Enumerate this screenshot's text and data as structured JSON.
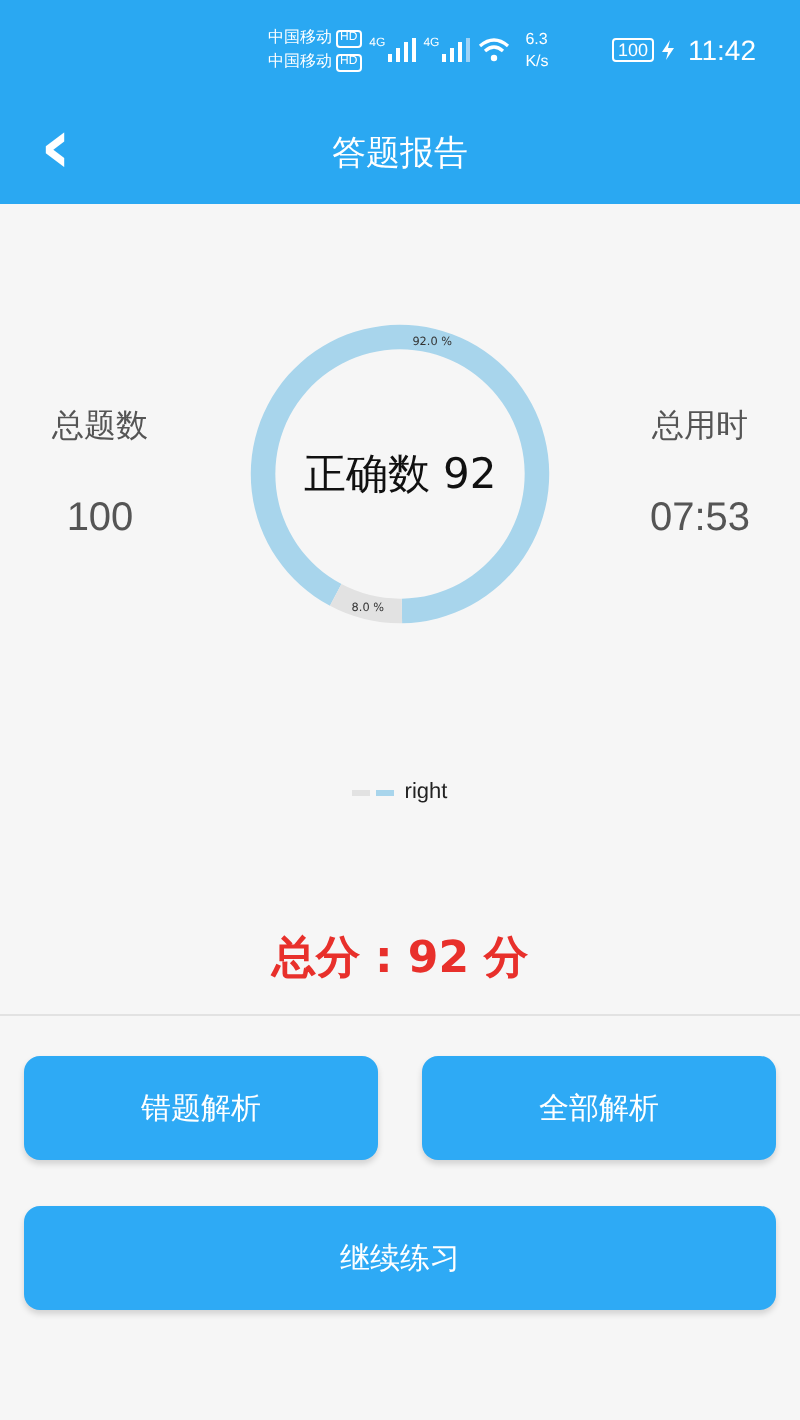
{
  "status_bar": {
    "carriers": [
      "中国移动",
      "中国移动"
    ],
    "hd_badges": [
      "HD",
      "HD"
    ],
    "network_types": [
      "4G",
      "4G"
    ],
    "speed_value": "6.3",
    "speed_unit": "K/s",
    "battery": "100",
    "time": "11:42"
  },
  "header": {
    "back": "‹",
    "title": "答题报告"
  },
  "stats": [
    {
      "label": "总题数",
      "value": "100"
    },
    {
      "label": "总用时",
      "value": "07:53"
    }
  ],
  "chart": {
    "center_text": "正确数 92",
    "legend": [
      {
        "color": "#e2e2e2"
      },
      {
        "color": "#a8d5ec",
        "label": "right"
      }
    ],
    "chart_data": {
      "type": "donut",
      "values": [
        92,
        8
      ],
      "value_labels": [
        "92.0 %",
        "8.0 %"
      ]
    }
  },
  "score": "总分 : 92 分",
  "buttons": [
    {
      "label": "错题解析",
      "kind": "half"
    },
    {
      "label": "全部解析",
      "kind": "half"
    },
    {
      "label": "继续练习",
      "kind": "full"
    }
  ]
}
